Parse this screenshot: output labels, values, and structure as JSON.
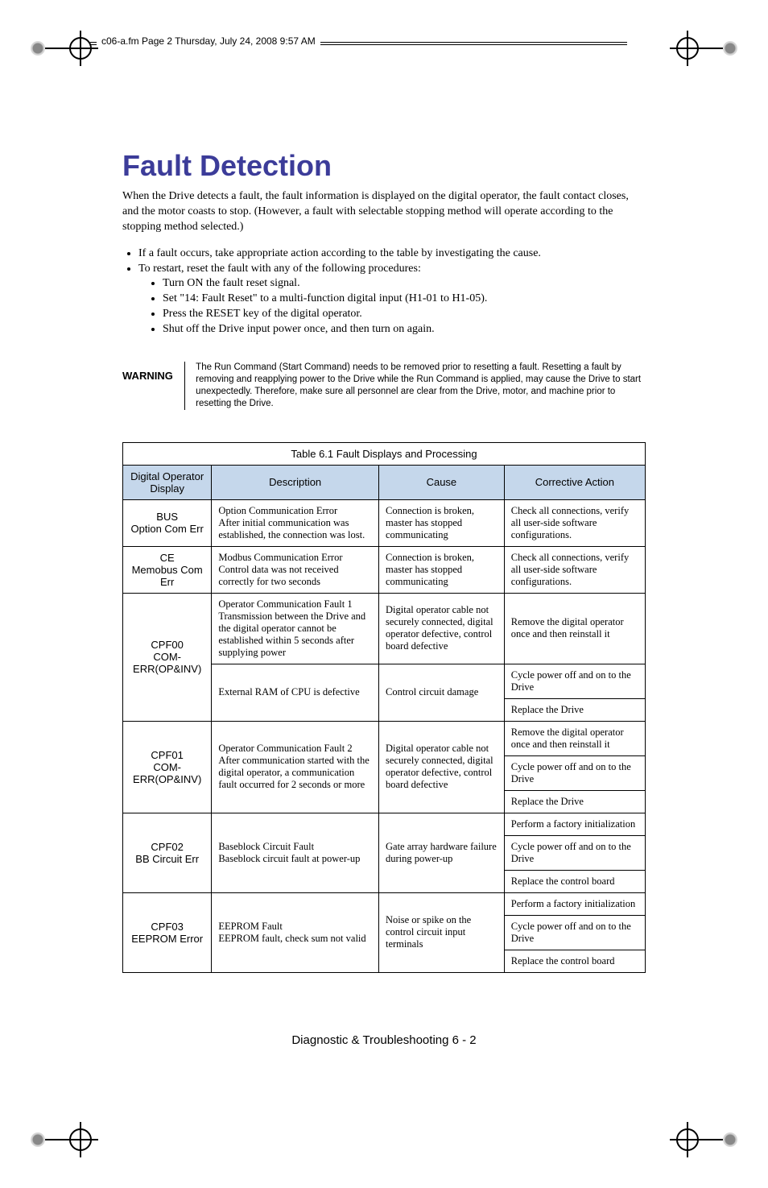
{
  "header_text": "c06-a.fm  Page 2  Thursday, July 24, 2008  9:57 AM",
  "title": "Fault Detection",
  "intro": "When the Drive detects a fault, the fault information is displayed on the digital operator, the fault contact closes, and the motor coasts to stop. (However, a fault with selectable stopping method will operate according to the stopping method selected.)",
  "bullets": {
    "b1": "If a fault occurs, take appropriate action according to the table by investigating the cause.",
    "b2": "To restart, reset the fault with any of the following procedures:",
    "s1": "Turn ON the fault reset signal.",
    "s2": "Set \"14: Fault Reset\" to a multi-function digital input (H1-01 to H1-05).",
    "s3": "Press the RESET key of the digital operator.",
    "s4": "Shut off the Drive input power once, and then turn on again."
  },
  "warning_label": "WARNING",
  "warning_text": "The Run Command (Start Command) needs to be removed prior to resetting a fault. Resetting a fault by removing and reapplying power to the Drive while the Run Command is applied, may cause the Drive to start unexpectedly. Therefore, make sure all personnel are clear from the Drive, motor, and machine prior to    resetting the Drive.",
  "table": {
    "caption": "Table 6.1  Fault Displays and Processing",
    "headers": {
      "h1": "Digital Operator Display",
      "h2": "Description",
      "h3": "Cause",
      "h4": "Corrective Action"
    },
    "rows": {
      "r1": {
        "c1a": "BUS",
        "c1b": "Option Com Err",
        "c2": "Option Communication Error\nAfter initial communication was established, the connection was lost.",
        "c3": "Connection is broken, master has stopped communicating",
        "c4": "Check all connections, verify all user-side software configurations."
      },
      "r2": {
        "c1a": "CE",
        "c1b": "Memobus Com Err",
        "c2": "Modbus Communication Error\nControl data was not received correctly for two seconds",
        "c3": "Connection is broken, master has stopped communicating",
        "c4": "Check all connections, verify all user-side software configurations."
      },
      "r3": {
        "c1a": "CPF00",
        "c1b": "COM-ERR(OP&INV)",
        "c2": "Operator Communication Fault 1\nTransmission between the Drive and the digital operator cannot be established within 5 seconds after supplying power",
        "c3": "Digital operator cable not securely connected, digital operator defective, control board defective",
        "c4": "Remove the digital operator once and then reinstall it"
      },
      "r3b": {
        "c2": "External RAM of CPU is defective",
        "c3": "Control circuit damage",
        "c4a": "Cycle power off and on to the Drive",
        "c4b": "Replace the Drive"
      },
      "r4": {
        "c1a": "CPF01",
        "c1b": "COM-ERR(OP&INV)",
        "c2": "Operator Communication Fault 2\nAfter communication started with the digital operator, a communication fault occurred for 2 seconds or more",
        "c3": "Digital operator cable not securely connected, digital operator defective, control board defective",
        "c4a": "Remove the digital operator once and then reinstall it",
        "c4b": "Cycle power off and on to the Drive",
        "c4c": "Replace the Drive"
      },
      "r5": {
        "c1a": "CPF02",
        "c1b": "BB Circuit Err",
        "c2": "Baseblock Circuit Fault\nBaseblock circuit fault at power-up",
        "c3": "Gate array hardware failure during power-up",
        "c4a": "Perform a factory initialization",
        "c4b": "Cycle power off and on to the Drive",
        "c4c": "Replace the control board"
      },
      "r6": {
        "c1a": "CPF03",
        "c1b": "EEPROM Error",
        "c2": "EEPROM Fault\nEEPROM fault, check sum not valid",
        "c3": "Noise or spike on the control circuit input terminals",
        "c4a": "Perform a factory initialization",
        "c4b": "Cycle power off and on to the Drive",
        "c4c": "Replace the control board"
      }
    }
  },
  "footer": "Diagnostic & Troubleshooting  6 - 2"
}
